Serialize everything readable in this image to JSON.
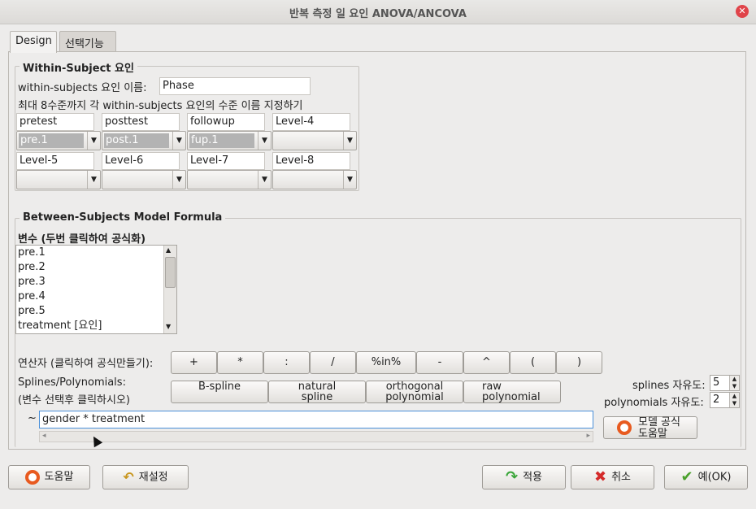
{
  "window": {
    "title": "반복 측정 일 요인 ANOVA/ANCOVA"
  },
  "tabs": [
    {
      "label": "Design",
      "active": true
    },
    {
      "label": "선택기능",
      "active": false
    }
  ],
  "within": {
    "group_title": "Within-Subject 요인",
    "factor_name_label": "within-subjects 요인 이름:",
    "factor_name_value": "Phase",
    "levels_hint": "최대 8수준까지 각 within-subjects 요인의 수준 이름 지정하기",
    "levels": [
      {
        "name": "pretest",
        "combo": "pre.1",
        "selected": true
      },
      {
        "name": "posttest",
        "combo": "post.1",
        "selected": true
      },
      {
        "name": "followup",
        "combo": "fup.1",
        "selected": true
      },
      {
        "name": "Level-4",
        "combo": "",
        "selected": false
      },
      {
        "name": "Level-5",
        "combo": "",
        "selected": false
      },
      {
        "name": "Level-6",
        "combo": "",
        "selected": false
      },
      {
        "name": "Level-7",
        "combo": "",
        "selected": false
      },
      {
        "name": "Level-8",
        "combo": "",
        "selected": false
      }
    ]
  },
  "between": {
    "group_title": "Between-Subjects Model Formula",
    "variables_label": "변수 (두번 클릭하여 공식화)",
    "variables": [
      "pre.1",
      "pre.2",
      "pre.3",
      "pre.4",
      "pre.5",
      "treatment [요인]"
    ],
    "operators_label": "연산자 (클릭하여 공식만들기):",
    "operators": [
      "+",
      "*",
      ":",
      "/",
      "%in%",
      "-",
      "^",
      "(",
      ")"
    ],
    "splines_label_1": "Splines/Polynomials:",
    "splines_label_2": "(변수 선택후 클릭하시오)",
    "splines_buttons": [
      {
        "line1": "B-spline",
        "line2": ""
      },
      {
        "line1": "natural",
        "line2": "spline"
      },
      {
        "line1": "orthogonal",
        "line2": "polynomial"
      },
      {
        "line1": "raw",
        "line2": "polynomial"
      }
    ],
    "splines_df_label": "splines 자유도:",
    "splines_df_value": "5",
    "poly_df_label": "polynomials 자유도:",
    "poly_df_value": "2",
    "tilde": "~",
    "formula_value": "gender * treatment",
    "model_help_line1": "모델 공식",
    "model_help_line2": "도움말"
  },
  "footer": {
    "help": "도움말",
    "reset": "재설정",
    "apply": "적용",
    "cancel": "취소",
    "ok": "예(OK)"
  },
  "colors": {
    "accent_focus": "#4a90d9",
    "close": "#e0444a",
    "apply_arrow": "#3aa63a",
    "cancel_x": "#d42a2a",
    "ok_check": "#4aa02c",
    "reset_arrow": "#c8961e"
  }
}
